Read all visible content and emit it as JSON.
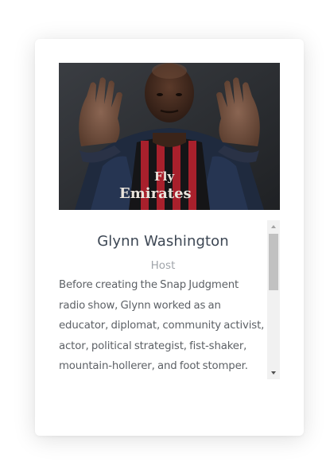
{
  "profile": {
    "name": "Glynn Washington",
    "role": "Host",
    "bio": "Before creating the Snap Judgment radio show, Glynn worked as an educator, diplomat, community activist, actor, political strategist, fist-shaker, mountain-hollerer, and foot stomper.",
    "photo_jersey_text_1": "Fly",
    "photo_jersey_text_2": "Emirates"
  },
  "scrollbar": {
    "up_icon": "triangle-up",
    "down_icon": "triangle-down",
    "position": 0
  },
  "colors": {
    "name": "#3d4754",
    "role": "#a0a4aa",
    "bio": "#5d6166",
    "jersey_red": "#a8202c",
    "jacket": "#1f2a3e"
  }
}
